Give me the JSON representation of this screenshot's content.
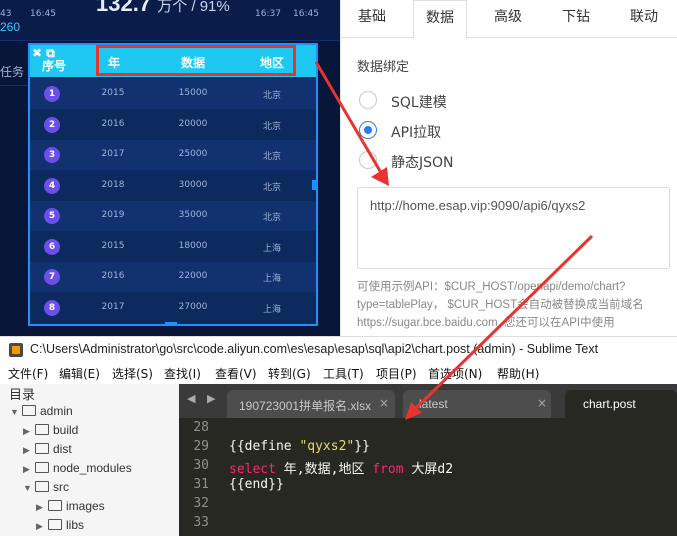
{
  "dashboard": {
    "top_texts": [
      "43",
      "16:45",
      "16:37",
      "16:45"
    ],
    "big_value": "132.7",
    "big_unit": "万个 / 91%",
    "left_value": "260",
    "left_label": "任务",
    "table": {
      "header_icons": "✖ ⧉",
      "headers": [
        "序号",
        "年",
        "数据",
        "地区"
      ],
      "rows": [
        {
          "no": "1",
          "year": "2015",
          "value": "15000",
          "region": "北京"
        },
        {
          "no": "2",
          "year": "2016",
          "value": "20000",
          "region": "北京"
        },
        {
          "no": "3",
          "year": "2017",
          "value": "25000",
          "region": "北京"
        },
        {
          "no": "4",
          "year": "2018",
          "value": "30000",
          "region": "北京"
        },
        {
          "no": "5",
          "year": "2019",
          "value": "35000",
          "region": "北京"
        },
        {
          "no": "6",
          "year": "2015",
          "value": "18000",
          "region": "上海"
        },
        {
          "no": "7",
          "year": "2016",
          "value": "22000",
          "region": "上海"
        },
        {
          "no": "8",
          "year": "2017",
          "value": "27000",
          "region": "上海"
        }
      ]
    }
  },
  "panel": {
    "tabs": [
      "基础",
      "数据",
      "高级",
      "下钻",
      "联动"
    ],
    "active_tab": "数据",
    "binding_label": "数据绑定",
    "options": [
      "SQL建模",
      "API拉取",
      "静态JSON"
    ],
    "selected_option": "API拉取",
    "api_url": "http://home.esap.vip:9090/api6/qyxs2",
    "help_text": "可使用示例API：$CUR_HOST/openapi/demo/chart?type=tablePlay， $CUR_HOST会自动被替换成当前域名https://sugar.bce.baidu.com. 您还可以在API中使用"
  },
  "sublime": {
    "title": "C:\\Users\\Administrator\\go\\src\\code.aliyun.com\\es\\esap\\esap\\sql\\api2\\chart.post (admin) - Sublime Text",
    "menu": [
      "文件(F)",
      "编辑(E)",
      "选择(S)",
      "查找(I)",
      "查看(V)",
      "转到(G)",
      "工具(T)",
      "项目(P)",
      "首选项(N)",
      "帮助(H)"
    ],
    "sidebar_title": "目录",
    "tree": [
      {
        "label": "admin",
        "depth": 0,
        "open": true
      },
      {
        "label": "build",
        "depth": 1,
        "open": false
      },
      {
        "label": "dist",
        "depth": 1,
        "open": false
      },
      {
        "label": "node_modules",
        "depth": 1,
        "open": false
      },
      {
        "label": "src",
        "depth": 1,
        "open": true
      },
      {
        "label": "images",
        "depth": 2,
        "open": false
      },
      {
        "label": "libs",
        "depth": 2,
        "open": false
      }
    ],
    "tabs": [
      {
        "label": "190723001拼单报名.xlsx",
        "close": "×",
        "active": false
      },
      {
        "label": "latest",
        "close": "×",
        "active": false
      },
      {
        "label": "chart.post",
        "close": "",
        "active": true
      }
    ],
    "line_numbers": [
      "28",
      "29",
      "30",
      "31",
      "32",
      "33"
    ],
    "code": {
      "l29_a": "{{define ",
      "l29_str": "\"qyxs2\"",
      "l29_b": "}}",
      "l30_kw1": "select",
      "l30_mid": " 年,数据,地区 ",
      "l30_kw2": "from",
      "l30_end": " 大屏d2",
      "l31": "{{end}}"
    }
  },
  "colors": {
    "annotation_red": "#e8332f",
    "table_header": "#1ec8f0",
    "badge": "#6a4fe8",
    "radio_accent": "#2b7de9",
    "editor_bg": "#272822"
  }
}
